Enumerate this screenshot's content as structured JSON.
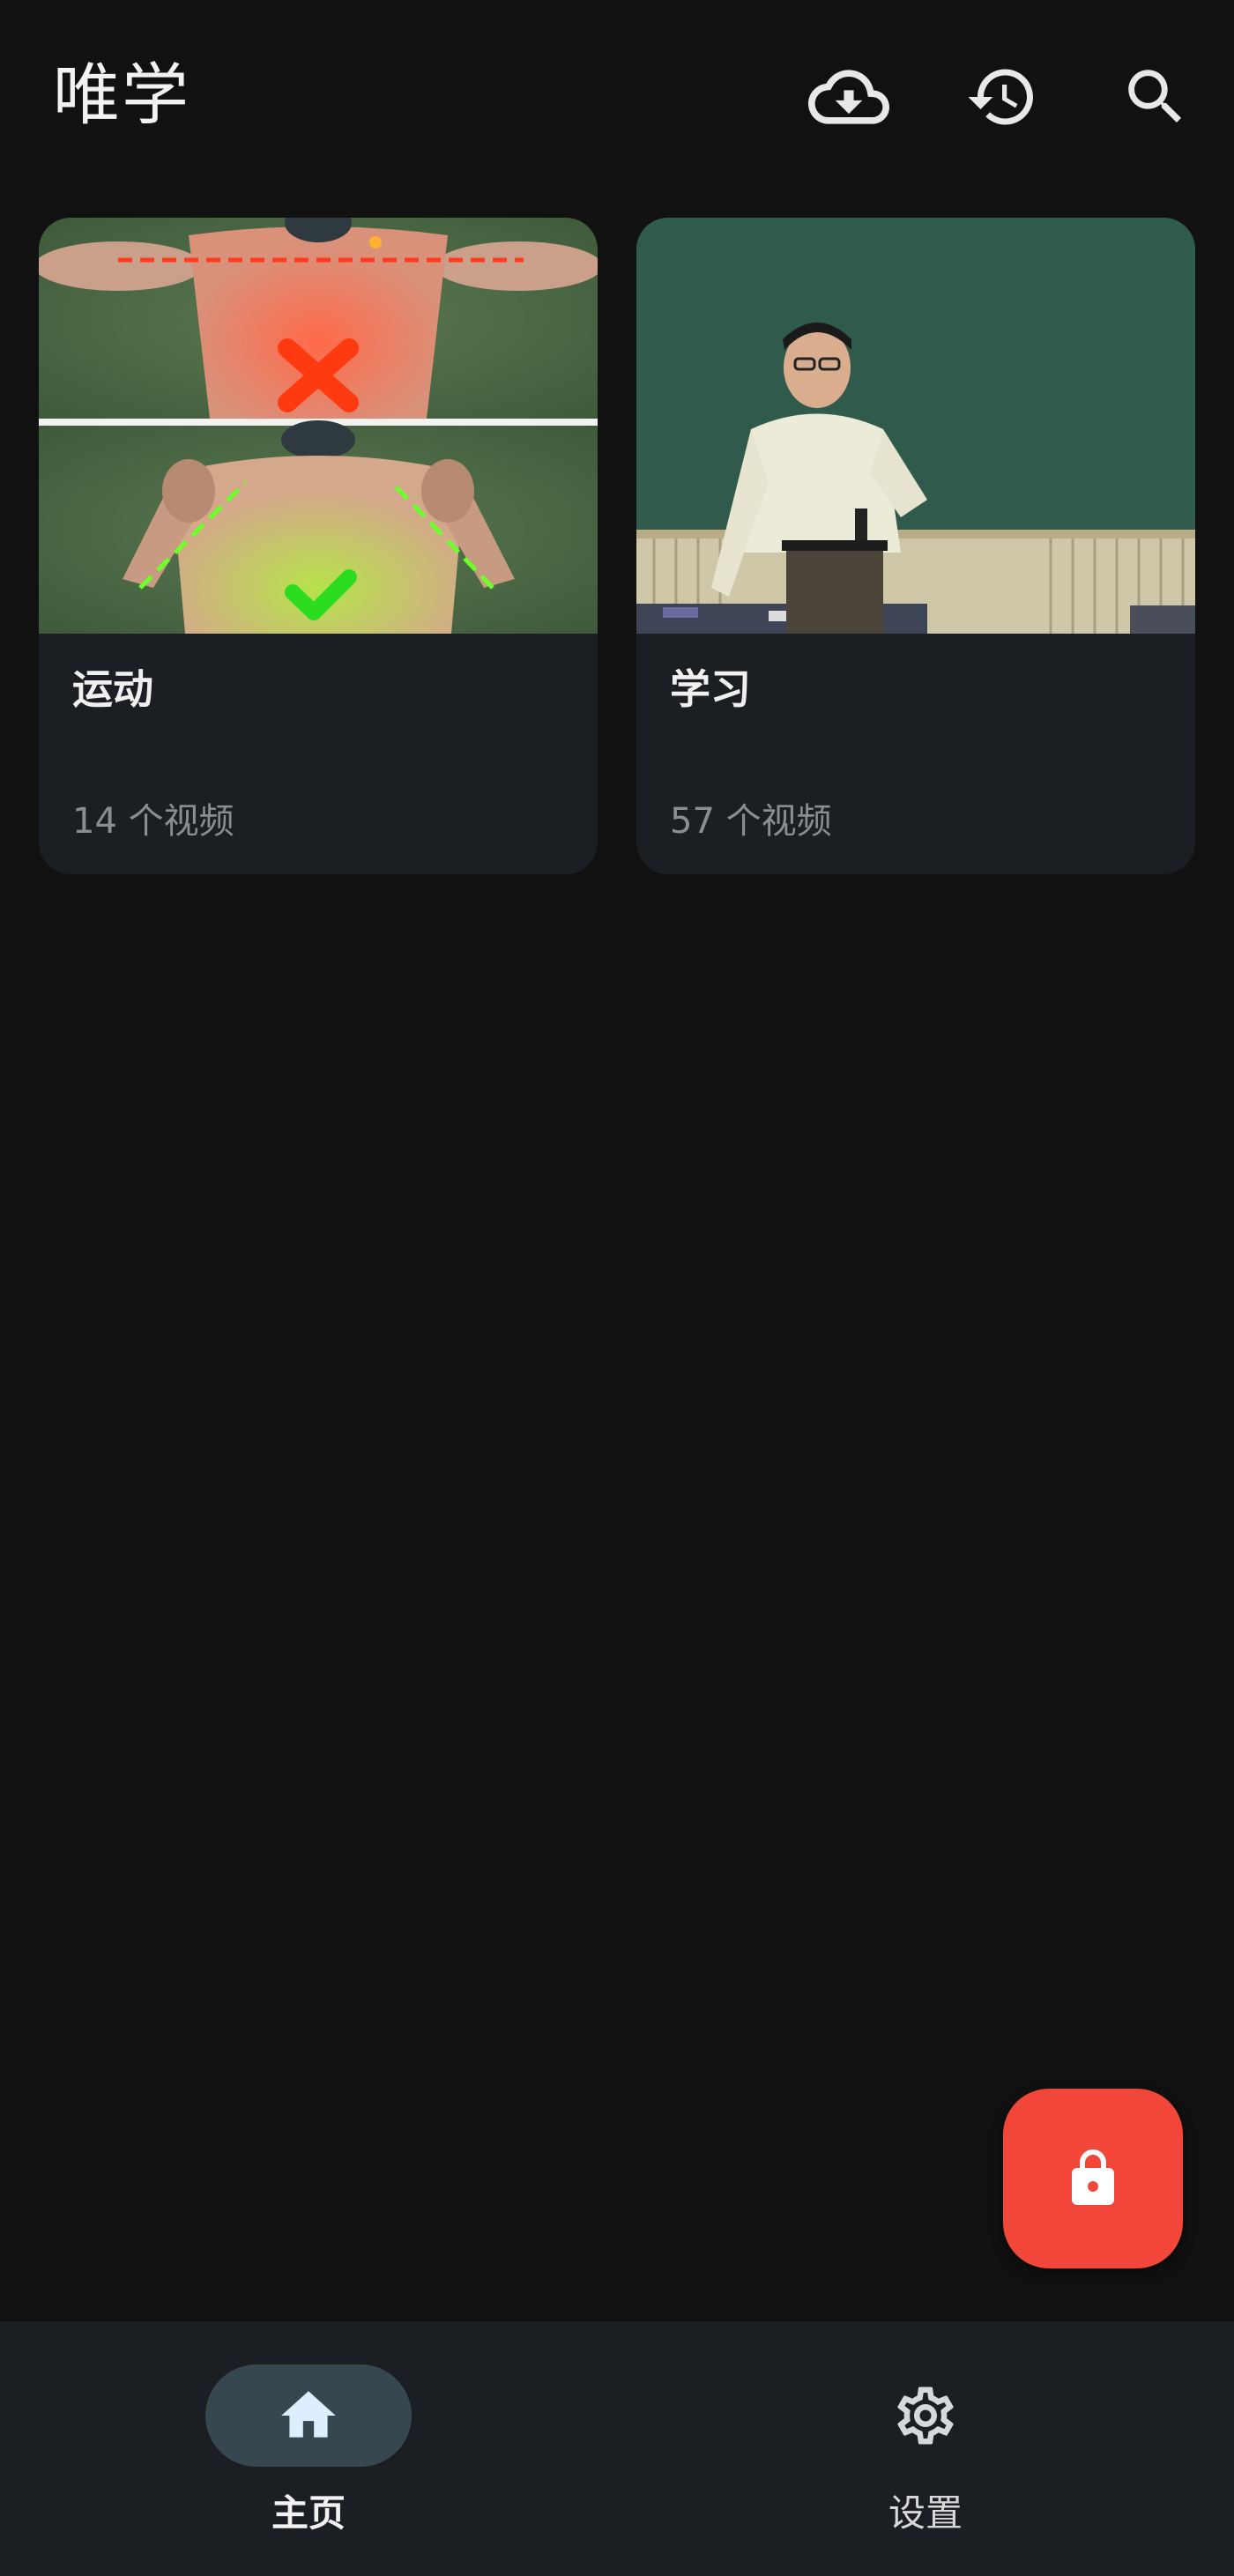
{
  "app": {
    "title": "唯学"
  },
  "header": {
    "actions": [
      {
        "icon": "cloud-download-icon",
        "label": ""
      },
      {
        "icon": "history-icon",
        "label": ""
      },
      {
        "icon": "search-icon",
        "label": ""
      }
    ]
  },
  "categories": [
    {
      "title": "运动",
      "count": "14 个视频",
      "thumbnail_icon": "exercise-thumbnail"
    },
    {
      "title": "学习",
      "count": "57 个视频",
      "thumbnail_icon": "lecture-thumbnail"
    }
  ],
  "fab": {
    "icon": "lock-icon",
    "color": "#f2463a"
  },
  "bottom_nav": {
    "items": [
      {
        "label": "主页",
        "icon": "home-icon",
        "selected": true
      },
      {
        "label": "设置",
        "icon": "gear-icon",
        "selected": false
      }
    ]
  },
  "colors": {
    "background": "#111111",
    "surface": "#1b1e22",
    "nav_selected_pill": "#37474f",
    "accent": "#f2463a"
  }
}
